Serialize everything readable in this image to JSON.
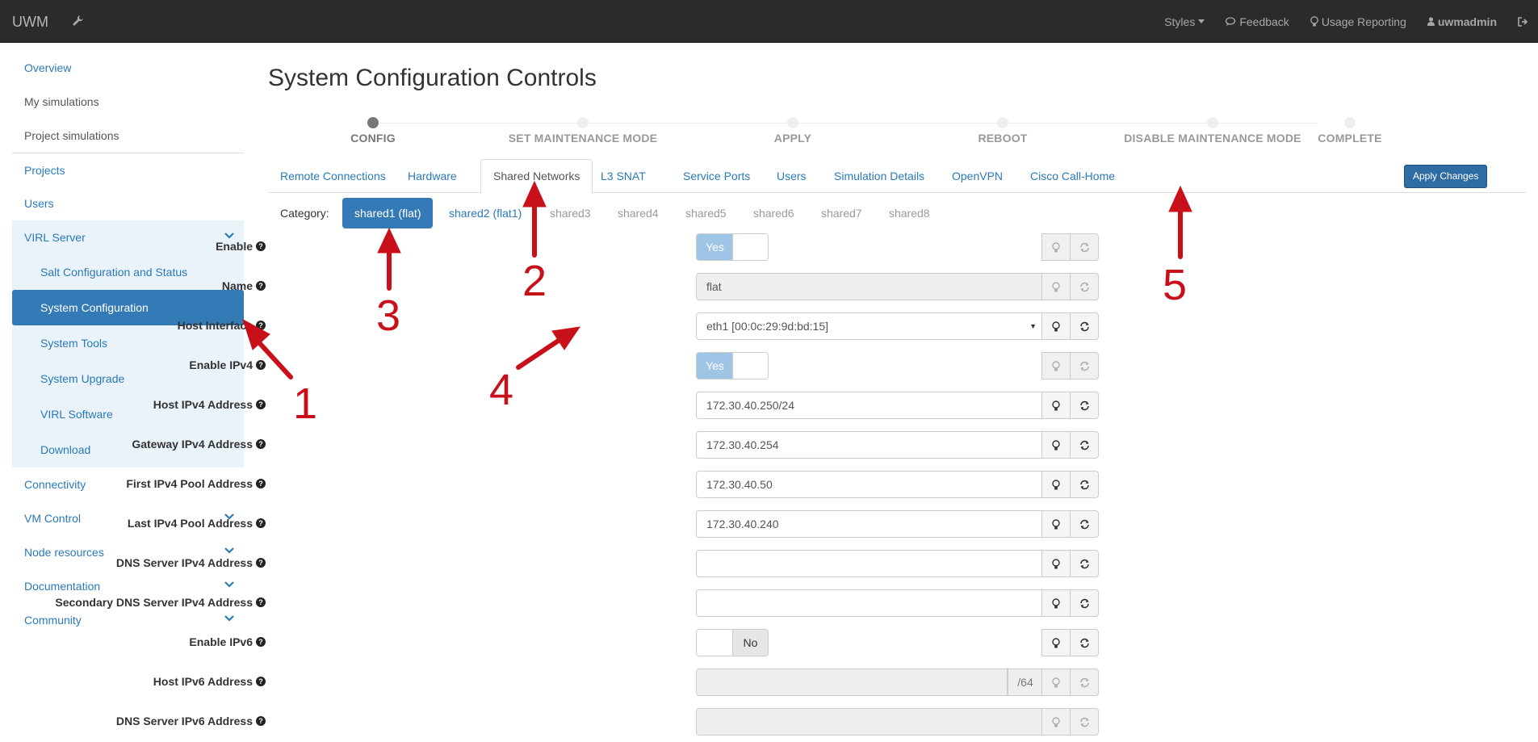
{
  "navbar": {
    "brand": "UWM",
    "styles": "Styles",
    "feedback": "Feedback",
    "usage": "Usage Reporting",
    "user": "uwmadmin"
  },
  "sidebar": {
    "items": [
      {
        "label": "Overview"
      },
      {
        "label": "My simulations"
      },
      {
        "label": "Project simulations"
      },
      {
        "label": "Projects"
      },
      {
        "label": "Users"
      },
      {
        "label": "VIRL Server"
      },
      {
        "label": "Salt Configuration and Status"
      },
      {
        "label": "System Configuration"
      },
      {
        "label": "System Tools"
      },
      {
        "label": "System Upgrade"
      },
      {
        "label": "VIRL Software"
      },
      {
        "label": "Download"
      },
      {
        "label": "Connectivity"
      },
      {
        "label": "VM Control"
      },
      {
        "label": "Node resources"
      },
      {
        "label": "Documentation"
      },
      {
        "label": "Community"
      }
    ]
  },
  "page": {
    "title": "System Configuration Controls"
  },
  "wizard": {
    "steps": [
      "CONFIG",
      "SET MAINTENANCE MODE",
      "APPLY",
      "REBOOT",
      "DISABLE MAINTENANCE MODE",
      "COMPLETE"
    ]
  },
  "tabs": [
    "Remote Connections",
    "Hardware",
    "Shared Networks",
    "L3 SNAT",
    "Service Ports",
    "Users",
    "Simulation Details",
    "OpenVPN",
    "Cisco Call-Home"
  ],
  "apply_button": "Apply Changes",
  "category": {
    "label": "Category:",
    "pills": [
      "shared1 (flat)",
      "shared2 (flat1)",
      "shared3",
      "shared4",
      "shared5",
      "shared6",
      "shared7",
      "shared8"
    ]
  },
  "form": {
    "enable": {
      "label": "Enable",
      "value": "Yes"
    },
    "name": {
      "label": "Name",
      "value": "flat"
    },
    "host_interface": {
      "label": "Host Interface",
      "value": "eth1 [00:0c:29:9d:bd:15]"
    },
    "enable_ipv4": {
      "label": "Enable IPv4",
      "value": "Yes"
    },
    "host_ipv4": {
      "label": "Host IPv4 Address",
      "value": "172.30.40.250/24"
    },
    "gateway_ipv4": {
      "label": "Gateway IPv4 Address",
      "value": "172.30.40.254"
    },
    "first_pool": {
      "label": "First IPv4 Pool Address",
      "value": "172.30.40.50"
    },
    "last_pool": {
      "label": "Last IPv4 Pool Address",
      "value": "172.30.40.240"
    },
    "dns_ipv4": {
      "label": "DNS Server IPv4 Address",
      "value": ""
    },
    "sec_dns_ipv4": {
      "label": "Secondary DNS Server IPv4 Address",
      "value": ""
    },
    "enable_ipv6": {
      "label": "Enable IPv6",
      "value": "No"
    },
    "host_ipv6": {
      "label": "Host IPv6 Address",
      "value": "",
      "suffix": "/64"
    },
    "dns_ipv6": {
      "label": "DNS Server IPv6 Address",
      "value": ""
    }
  },
  "annotations": [
    "1",
    "2",
    "3",
    "4",
    "5"
  ],
  "colors": {
    "navbar": "#2b2b2b",
    "accent": "#337ab7",
    "annotation": "#c8101a"
  }
}
